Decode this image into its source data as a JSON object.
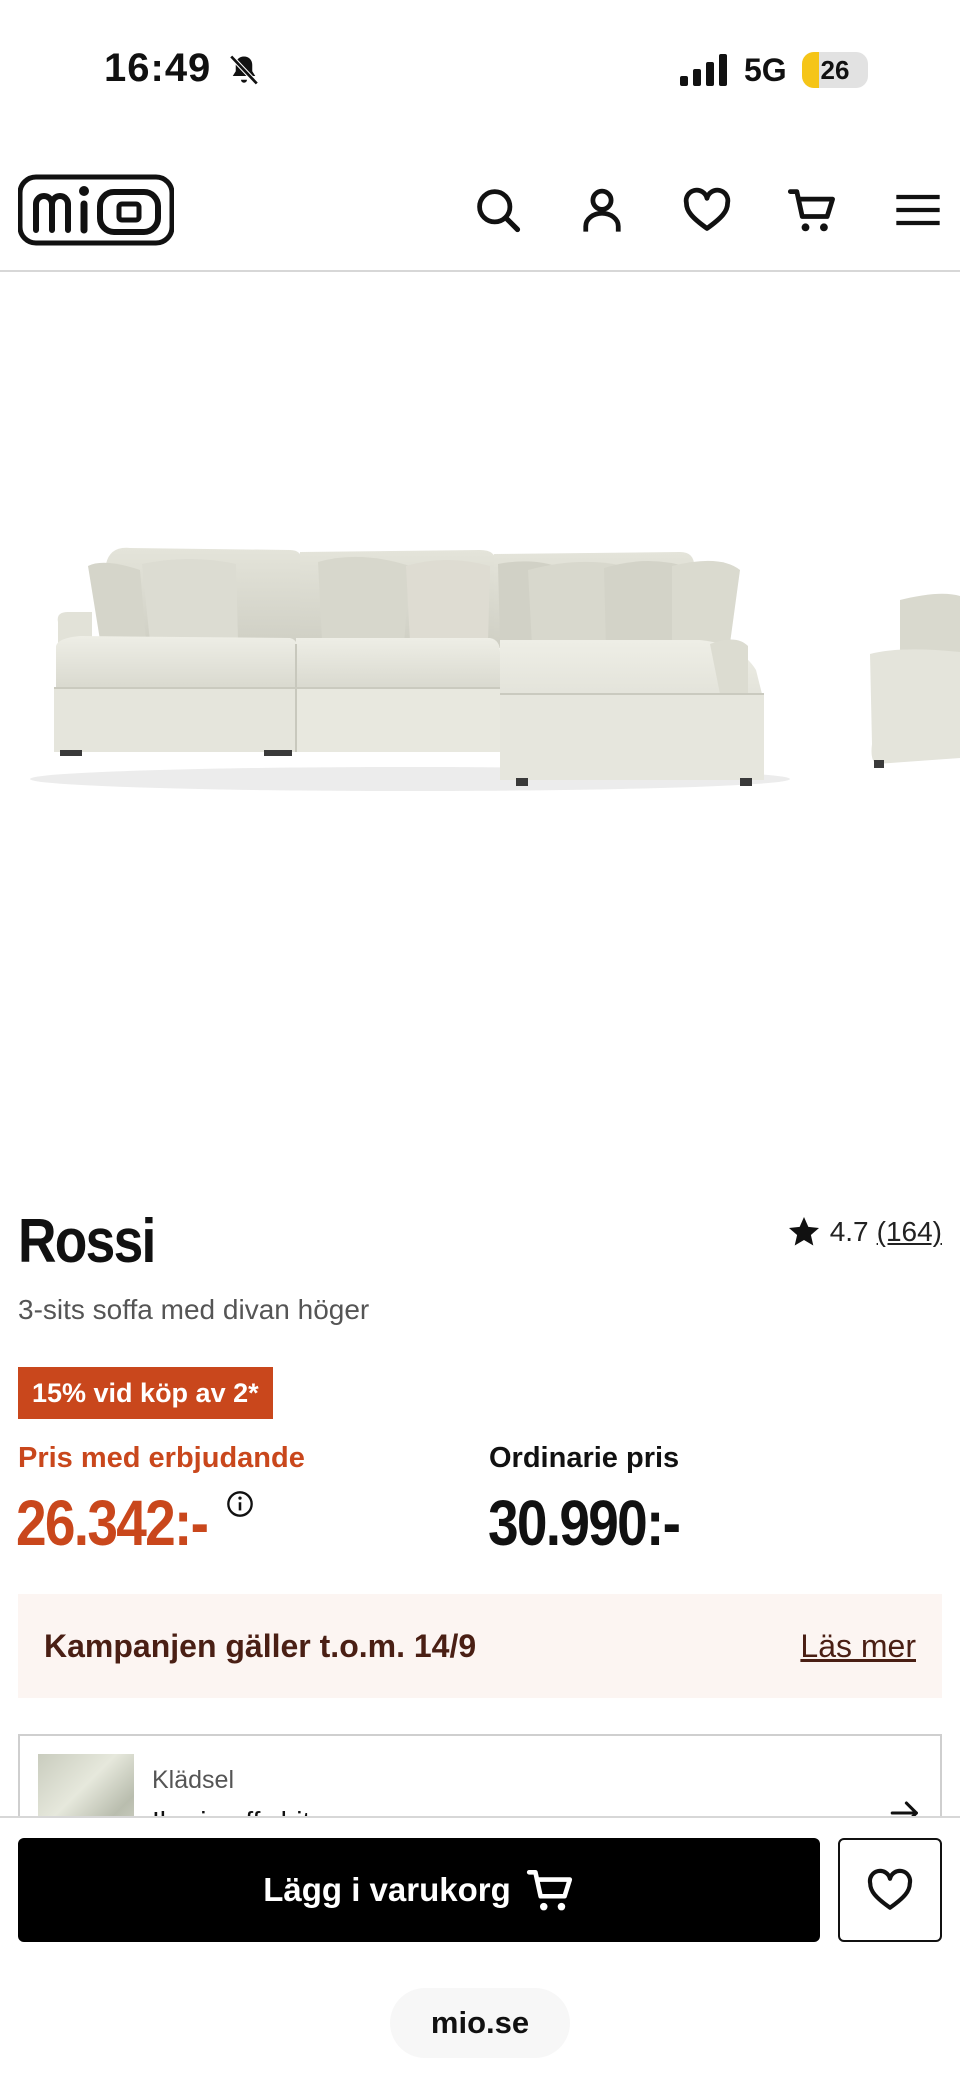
{
  "status_bar": {
    "time": "16:49",
    "network": "5G",
    "battery": "26",
    "battery_level": 0.26
  },
  "header": {
    "logo_text": "mio",
    "icons": [
      "search-icon",
      "account-icon",
      "heart-icon",
      "cart-icon",
      "menu-icon"
    ]
  },
  "product": {
    "name": "Rossi",
    "subtitle": "3-sits soffa med divan höger",
    "rating": "4.7",
    "reviews_count": "(164)",
    "badge": "15% vid köp av 2*",
    "offer_label": "Pris med erbjudande",
    "offer_price": "26.342:-",
    "regular_label": "Ordinarie pris",
    "regular_price": "30.990:-"
  },
  "campaign": {
    "text": "Kampanjen gäller t.o.m. 14/9",
    "link": "Läs mer"
  },
  "option": {
    "label": "Klädsel",
    "value": "Iberia offwhite"
  },
  "bottom_bar": {
    "add_to_cart": "Lägg i varukorg",
    "url": "mio.se"
  },
  "colors": {
    "accent": "#c9471c",
    "campaign_bg": "#fcf5f2",
    "campaign_text": "#4a1f14"
  }
}
